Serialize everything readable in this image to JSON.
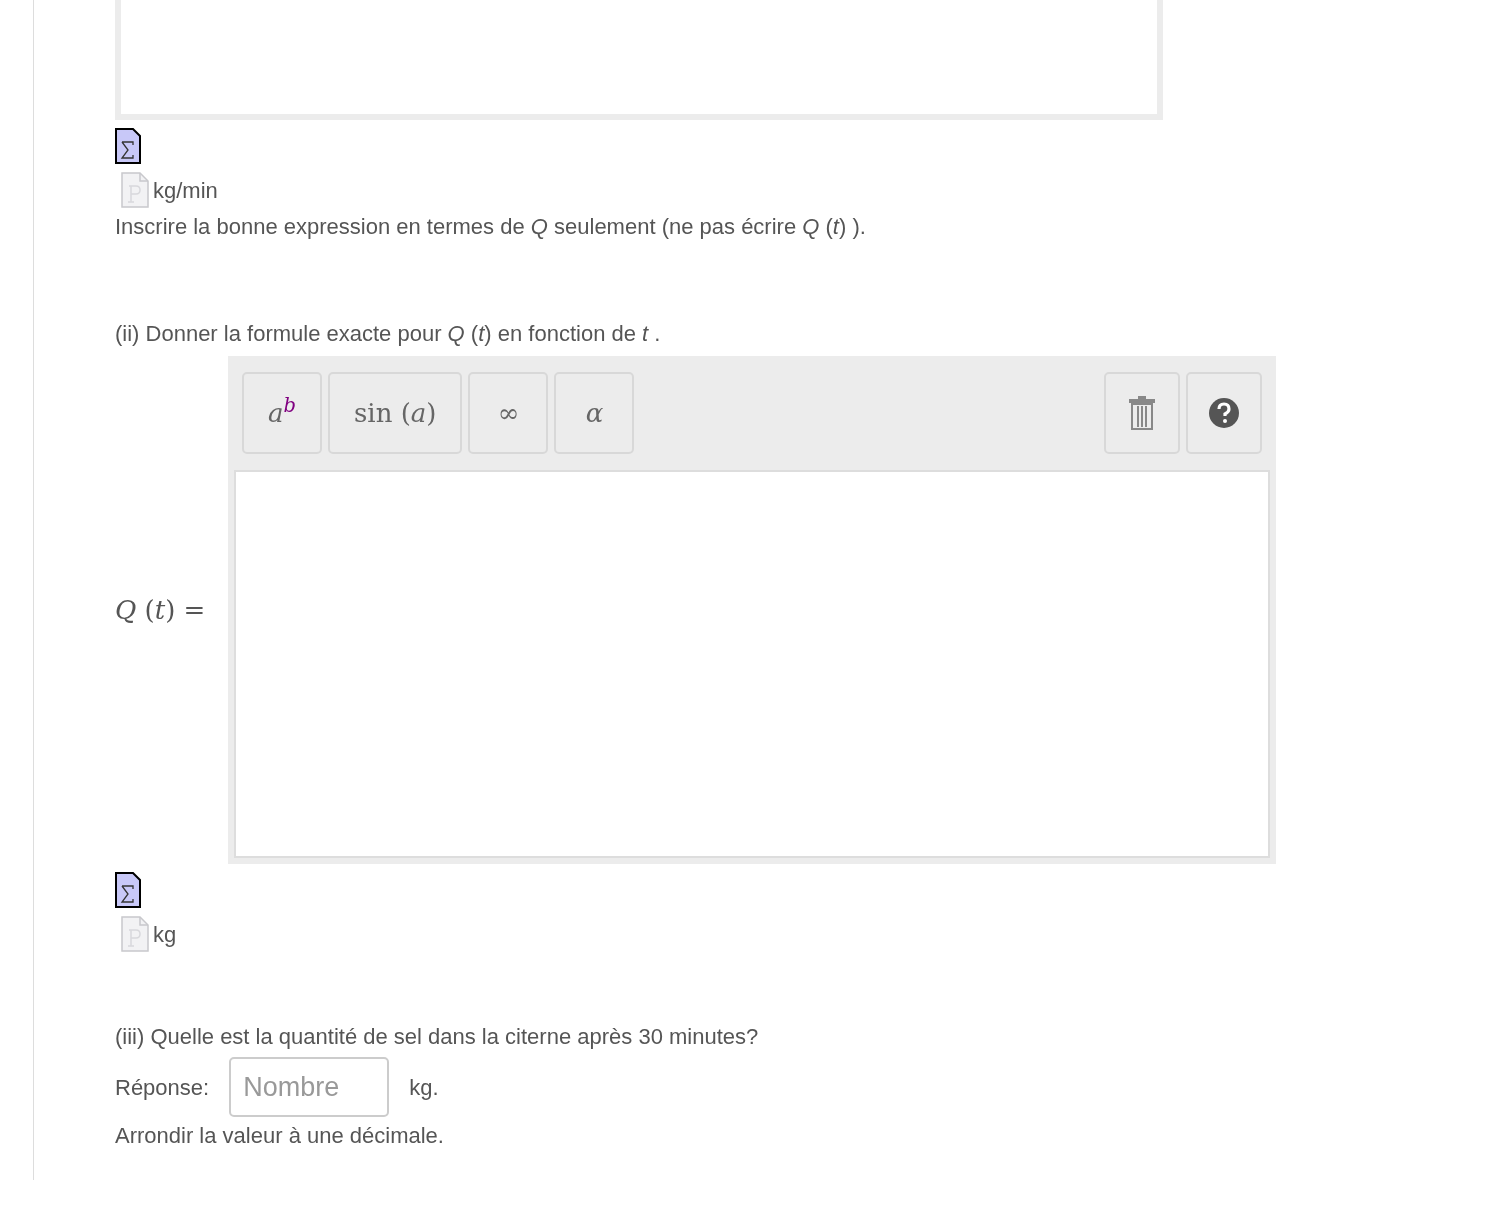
{
  "part_i": {
    "unit": "kg/min",
    "note": "Inscrire la bonne expression en termes de *Q*  seulement (ne pas écrire *Q* (*t*) )."
  },
  "part_ii": {
    "prompt": "(ii) Donner la formule exacte pour *Q* (*t*)  en fonction de *t* .",
    "lhs": "*Q* (*t*) =",
    "toolbar": [
      {
        "label": "*a*$^{b}$"
      },
      {
        "label": "sin (*a*)"
      },
      {
        "label": "∞"
      },
      {
        "label": "*α*"
      }
    ],
    "unit": "kg"
  },
  "part_iii": {
    "prompt": "(iii) Quelle est la quantité de sel dans la citerne après 30  minutes?",
    "answer_label": "Réponse:",
    "placeholder": "Nombre",
    "unit": "kg.",
    "hint": "Arrondir la valeur à une décimale."
  }
}
